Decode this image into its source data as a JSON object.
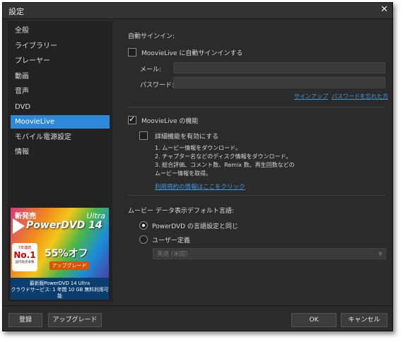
{
  "window": {
    "title": "設定",
    "close_glyph": "✕"
  },
  "sidebar": {
    "items": [
      {
        "label": "全般"
      },
      {
        "label": "ライブラリー"
      },
      {
        "label": "プレーヤー"
      },
      {
        "label": "動画"
      },
      {
        "label": "音声"
      },
      {
        "label": "DVD"
      },
      {
        "label": "MoovieLive"
      },
      {
        "label": "モバイル電源設定"
      },
      {
        "label": "情報"
      }
    ],
    "active_index": 6
  },
  "ad": {
    "new_label": "新発売",
    "edition": "Ultra",
    "product": "PowerDVD 14",
    "badge_top": "7年連続",
    "badge_main": "No.1",
    "badge_bottom": "国内販売本数",
    "discount": "55%オフ",
    "upgrade_label": "アップグレード",
    "caption_line1": "最新版PowerDVD 14 Ultra",
    "caption_line2": "クラウドサービス: 1 年間 10 GB 無料利用可能"
  },
  "signin": {
    "heading": "自動サインイン:",
    "auto_signin_label": "MoovieLive に自動サインインする",
    "auto_signin_checked": false,
    "email_label": "メール:",
    "email_value": "",
    "password_label": "パスワード:",
    "password_value": "",
    "signup_link": "サインアップ",
    "forgot_link": "パスワードを忘れた方"
  },
  "features": {
    "moovielive_label": "MoovieLive の機能",
    "moovielive_checked": true,
    "advanced_label": "詳細機能を有効にする",
    "advanced_checked": false,
    "desc_line1": "1. ムービー情報をダウンロード。",
    "desc_line2": "2. チャプター名などのディスク情報をダウンロード。",
    "desc_line3": "3. 総合評価、コメント数、Remix 数、再生回数などの",
    "desc_line4": "ムービー情報を取得。",
    "terms_link": "利用規約の情報はここをクリック"
  },
  "language": {
    "heading": "ムービー データ表示デフォルト言語:",
    "option_same": "PowerDVD の言語設定と同じ",
    "option_user": "ユーザー定義",
    "selected": "same",
    "dropdown_value": "英語 (米国)",
    "dropdown_arrow": "▼"
  },
  "footer": {
    "register_label": "登録",
    "upgrade_label": "アップグレード",
    "ok_label": "OK",
    "cancel_label": "キャンセル"
  }
}
